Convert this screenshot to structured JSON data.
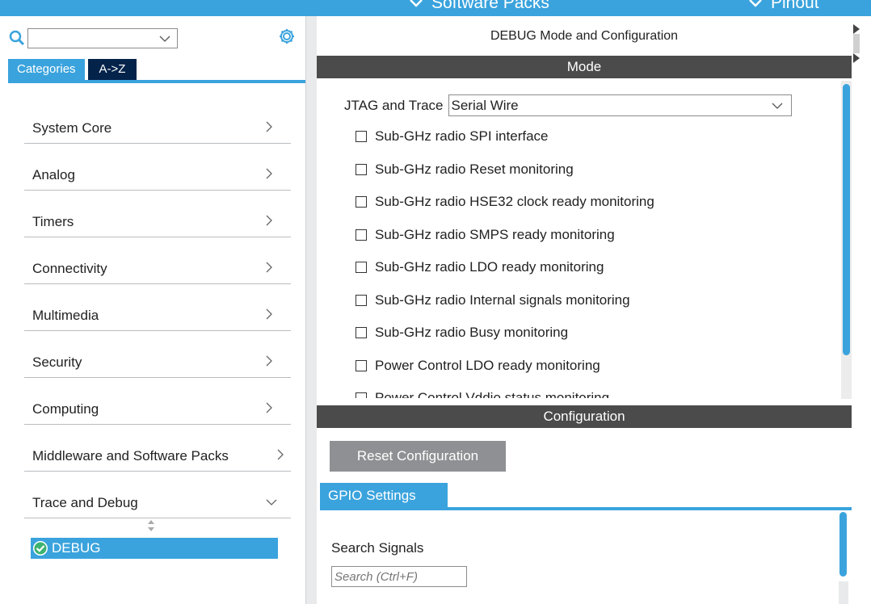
{
  "topbar": {
    "software_packs": "Software Packs",
    "pinout": "Pinout"
  },
  "left": {
    "search_value": "",
    "tabs": [
      {
        "label": "Categories"
      },
      {
        "label": "A->Z"
      }
    ],
    "categories": [
      {
        "label": "System Core"
      },
      {
        "label": "Analog"
      },
      {
        "label": "Timers"
      },
      {
        "label": "Connectivity"
      },
      {
        "label": "Multimedia"
      },
      {
        "label": "Security"
      },
      {
        "label": "Computing"
      },
      {
        "label": "Middleware and Software Packs"
      },
      {
        "label": "Trace and Debug"
      }
    ],
    "selected_item": "DEBUG"
  },
  "right": {
    "title": "DEBUG Mode and Configuration",
    "mode_header": "Mode",
    "jtag_label": "JTAG and Trace",
    "jtag_value": "Serial Wire",
    "checkboxes": [
      {
        "label": "Sub-GHz radio SPI interface"
      },
      {
        "label": "Sub-GHz radio Reset monitoring"
      },
      {
        "label": "Sub-GHz radio HSE32 clock ready monitoring"
      },
      {
        "label": "Sub-GHz radio SMPS ready monitoring"
      },
      {
        "label": "Sub-GHz radio LDO ready monitoring"
      },
      {
        "label": "Sub-GHz radio Internal signals monitoring"
      },
      {
        "label": "Sub-GHz radio Busy monitoring"
      },
      {
        "label": "Power Control LDO ready monitoring"
      },
      {
        "label": "Power Control Vddio status monitoring"
      }
    ],
    "config_header": "Configuration",
    "reset_label": "Reset Configuration",
    "gpio_tab": "GPIO Settings",
    "search_signals_label": "Search Signals",
    "search_signals_placeholder": "Search (Ctrl+F)"
  },
  "colors": {
    "accent": "#3aa3dd",
    "header_bar": "#4b4b4b",
    "dark_tab": "#03234b"
  }
}
